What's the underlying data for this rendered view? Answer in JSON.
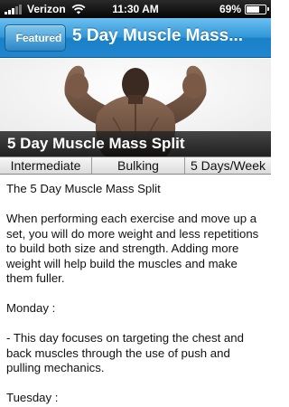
{
  "status_bar": {
    "carrier": "Verizon",
    "time": "11:30 AM",
    "battery": "69%",
    "battery_level": 0.69,
    "icons": [
      "signal-icon",
      "wifi-icon",
      "battery-icon"
    ]
  },
  "nav": {
    "back_label": "Featured",
    "title": "5 Day Muscle Mass..."
  },
  "hero": {
    "caption": "5 Day Muscle Mass Split"
  },
  "info": {
    "level": "Intermediate",
    "goal": "Bulking",
    "frequency": "5 Days/Week"
  },
  "body": {
    "paragraphs": [
      "The 5 Day Muscle Mass Split",
      "When performing each exercise and move up a set, you will do more weight and less repetitions to build both size and strength. Adding more weight will help build the muscles and make them fuller.",
      "Monday :",
      "- This day focuses on targeting the chest and back muscles through the use of push and pulling mechanics.",
      "Tuesday :"
    ]
  },
  "colors": {
    "nav_accent": "#2f95d8",
    "status_bar": "#000000"
  }
}
